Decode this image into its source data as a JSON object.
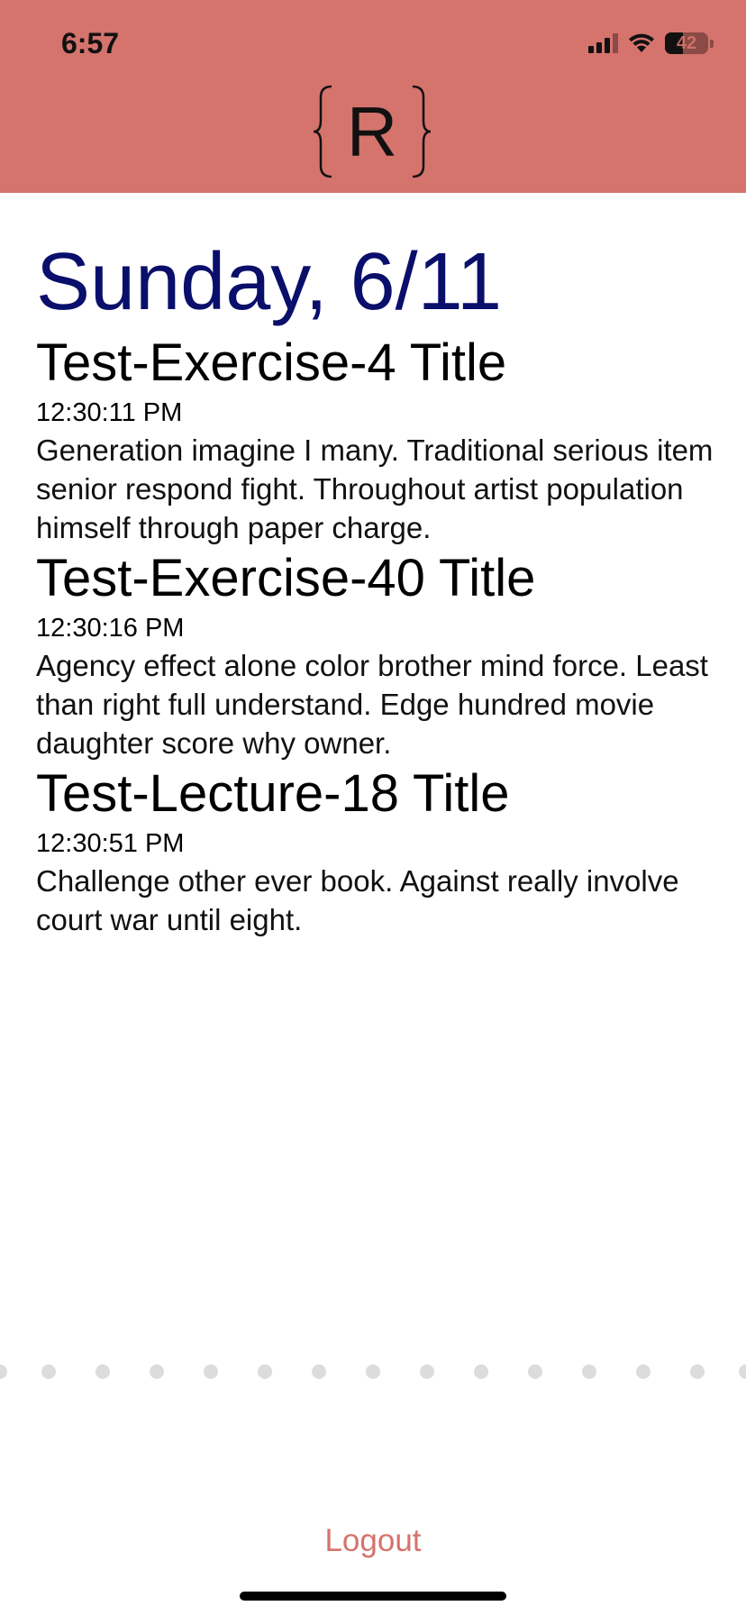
{
  "status_bar": {
    "time": "6:57",
    "battery": "42",
    "icons": [
      "cellular-signal-icon",
      "wifi-icon",
      "battery-icon"
    ]
  },
  "header": {
    "logo_letter": "R",
    "background_color": "#d5736d"
  },
  "day": {
    "title": "Sunday, 6/11",
    "title_color": "#0a0f6b"
  },
  "entries": [
    {
      "title": "Test-Exercise-4 Title",
      "time": "12:30:11 PM",
      "body": "Generation imagine I many. Traditional serious item senior respond fight. Throughout artist population himself through paper charge."
    },
    {
      "title": "Test-Exercise-40 Title",
      "time": "12:30:16 PM",
      "body": "Agency effect alone color brother mind force. Least than right full understand. Edge hundred movie daughter score why owner."
    },
    {
      "title": "Test-Lecture-18 Title",
      "time": "12:30:51 PM",
      "body": "Challenge other ever book. Against really involve court war until eight."
    }
  ],
  "page_indicator": {
    "dot_color": "#dcdcdc"
  },
  "footer": {
    "logout_label": "Logout",
    "logout_color": "#d5736d"
  }
}
